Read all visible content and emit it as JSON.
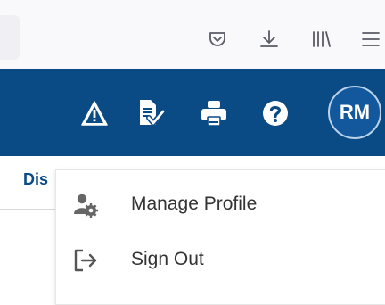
{
  "browser_toolbar": {
    "icons": [
      "pocket-icon",
      "download-icon",
      "library-icon",
      "menu-icon"
    ]
  },
  "header": {
    "icons": [
      "warning-icon",
      "document-check-icon",
      "print-icon",
      "help-icon"
    ],
    "avatar": {
      "initials": "RM"
    },
    "colors": {
      "background": "#0a4a85",
      "avatar": "#13589c"
    }
  },
  "page": {
    "tab_label": "Dis"
  },
  "profile_menu": {
    "items": [
      {
        "label": "Manage Profile",
        "icon": "user-gear-icon"
      },
      {
        "label": "Sign Out",
        "icon": "sign-out-icon"
      }
    ]
  }
}
